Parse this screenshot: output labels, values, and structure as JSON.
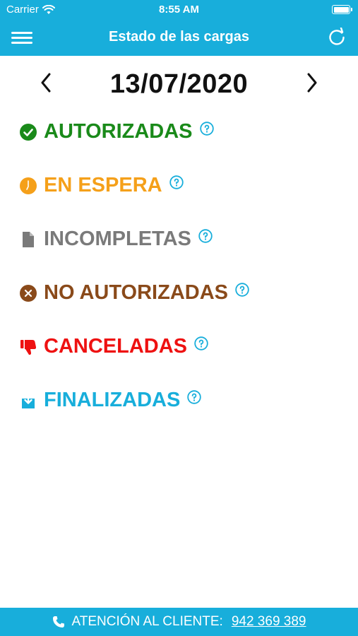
{
  "status_bar": {
    "carrier": "Carrier",
    "time": "8:55 AM"
  },
  "nav": {
    "title": "Estado de las cargas"
  },
  "date": "13/07/2020",
  "statuses": [
    {
      "label": "AUTORIZADAS",
      "color": "#1a8a1a",
      "icon": "check-circle-icon"
    },
    {
      "label": "EN ESPERA",
      "color": "#f5a01a",
      "icon": "clock-circle-icon"
    },
    {
      "label": "INCOMPLETAS",
      "color": "#7a7a7a",
      "icon": "document-icon"
    },
    {
      "label": "NO AUTORIZADAS",
      "color": "#8a4a1a",
      "icon": "x-circle-icon"
    },
    {
      "label": "CANCELADAS",
      "color": "#ee1111",
      "icon": "thumbs-down-icon"
    },
    {
      "label": "FINALIZADAS",
      "color": "#18aedb",
      "icon": "download-box-icon"
    }
  ],
  "footer": {
    "label": "ATENCIÓN AL CLIENTE:",
    "phone": "942 369 389"
  },
  "colors": {
    "brand": "#18aedb",
    "help": "#18aedb"
  }
}
